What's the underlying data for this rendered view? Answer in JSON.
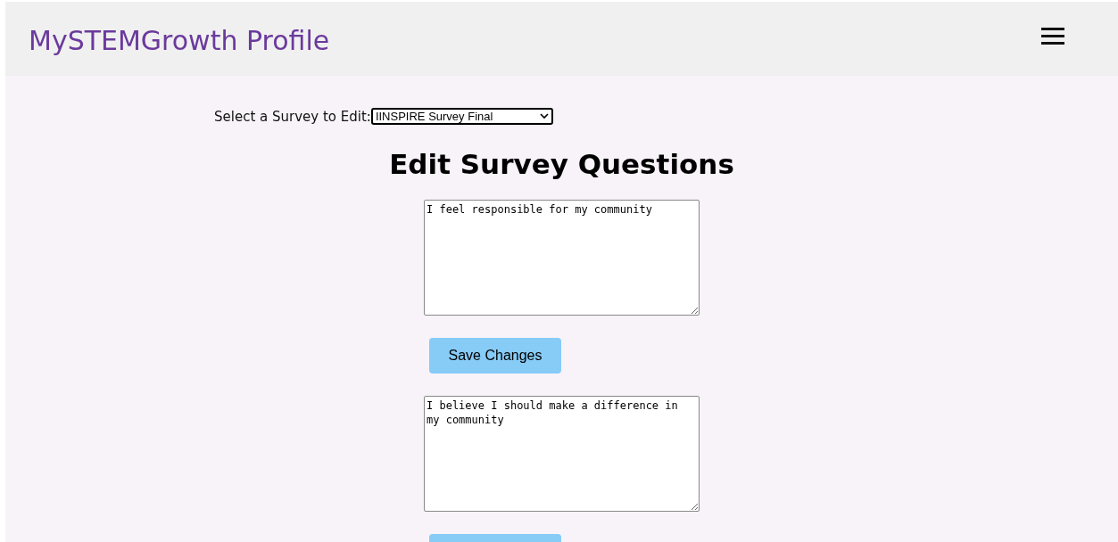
{
  "header": {
    "title": "MySTEMGrowth Profile"
  },
  "survey_select": {
    "label": "Select a Survey to Edit:",
    "value": "IINSPIRE Survey Final"
  },
  "heading": "Edit Survey Questions",
  "questions": [
    {
      "text": "I feel responsible for my community",
      "button": "Save Changes"
    },
    {
      "text": "I believe I should make a difference in my community"
    }
  ]
}
